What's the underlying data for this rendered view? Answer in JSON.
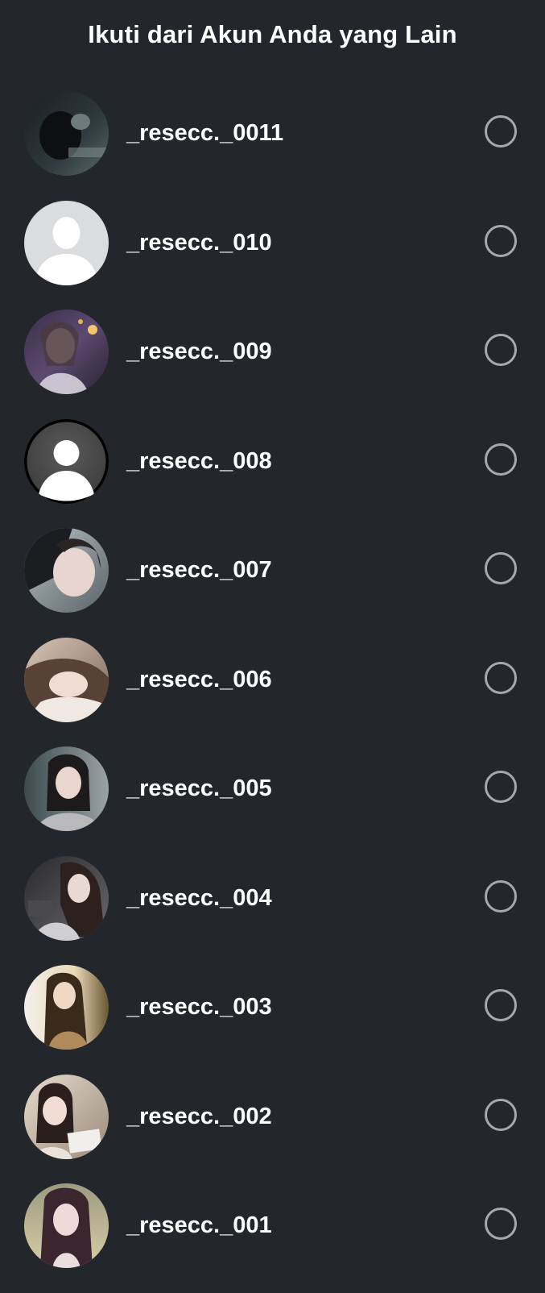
{
  "header": {
    "title": "Ikuti dari Akun Anda yang Lain"
  },
  "accounts": [
    {
      "username": "_resecc._0011",
      "avatar": "photo-dark",
      "selected": false
    },
    {
      "username": "_resecc._010",
      "avatar": "default-silhouette-gray",
      "selected": false
    },
    {
      "username": "_resecc._009",
      "avatar": "photo-night-purple",
      "selected": false
    },
    {
      "username": "_resecc._008",
      "avatar": "default-silhouette-dark",
      "selected": false
    },
    {
      "username": "_resecc._007",
      "avatar": "photo-closeup",
      "selected": false
    },
    {
      "username": "_resecc._006",
      "avatar": "photo-lying",
      "selected": false
    },
    {
      "username": "_resecc._005",
      "avatar": "photo-car",
      "selected": false
    },
    {
      "username": "_resecc._004",
      "avatar": "photo-long-hair",
      "selected": false
    },
    {
      "username": "_resecc._003",
      "avatar": "photo-warm",
      "selected": false
    },
    {
      "username": "_resecc._002",
      "avatar": "photo-cafe",
      "selected": false
    },
    {
      "username": "_resecc._001",
      "avatar": "photo-beige",
      "selected": false
    }
  ],
  "colors": {
    "background": "#23262b",
    "text": "#ffffff",
    "radio_border": "#a6a8ac"
  }
}
